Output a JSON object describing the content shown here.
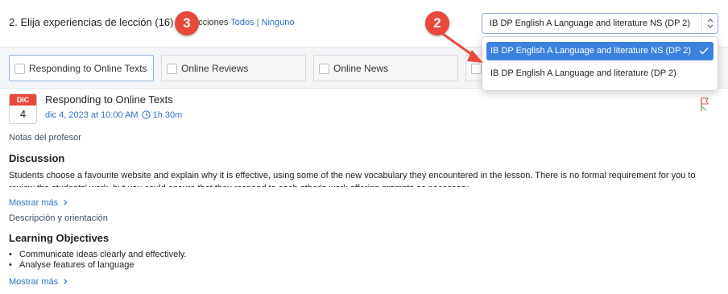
{
  "header": {
    "step_title": "2. Elija experiencias de lección (16)",
    "selections_label": "ecciones",
    "select_all": "Todos",
    "separator": "|",
    "select_none": "Ninguno"
  },
  "badges": {
    "step3": "3",
    "step2": "2",
    "color": "#e8493a"
  },
  "course_select": {
    "value": "IB DP English A Language and literature NS (DP 2)",
    "options": [
      "IB DP English A Language and literature NS (DP 2)",
      "IB DP English A Language and literature (DP 2)"
    ]
  },
  "experiences": [
    "Responding to Online Texts",
    "Online Reviews",
    "Online News"
  ],
  "lesson": {
    "month": "DIC",
    "day": "4",
    "title": "Responding to Online Texts",
    "datetime": "dic 4, 2023 at 10:00 AM",
    "duration": "1h 30m",
    "teacher_notes_label": "Notas del profesor",
    "discussion_heading": "Discussion",
    "discussion_text": "Students choose a favourite website and explain why it is effective, using some of the new vocabulary they encountered in the lesson. There is no formal requirement for you to review the students' work, but you could ensure that they respond to each other's work offering prompts as necessary.",
    "show_more_1": "Mostrar más",
    "description_label": "Descripción y orientación",
    "objectives_heading": "Learning Objectives",
    "objectives": [
      "Communicate ideas clearly and effectively.",
      "Analyse features of language"
    ],
    "show_more_2": "Mostrar más"
  },
  "colors": {
    "accent": "#2f72c4",
    "selected_option": "#3b82e0",
    "calendar_red": "#e8493a"
  },
  "icons": [
    "chevron-right-icon",
    "clock-icon",
    "checkmark-icon",
    "select-arrows-icon",
    "flag-icon"
  ]
}
